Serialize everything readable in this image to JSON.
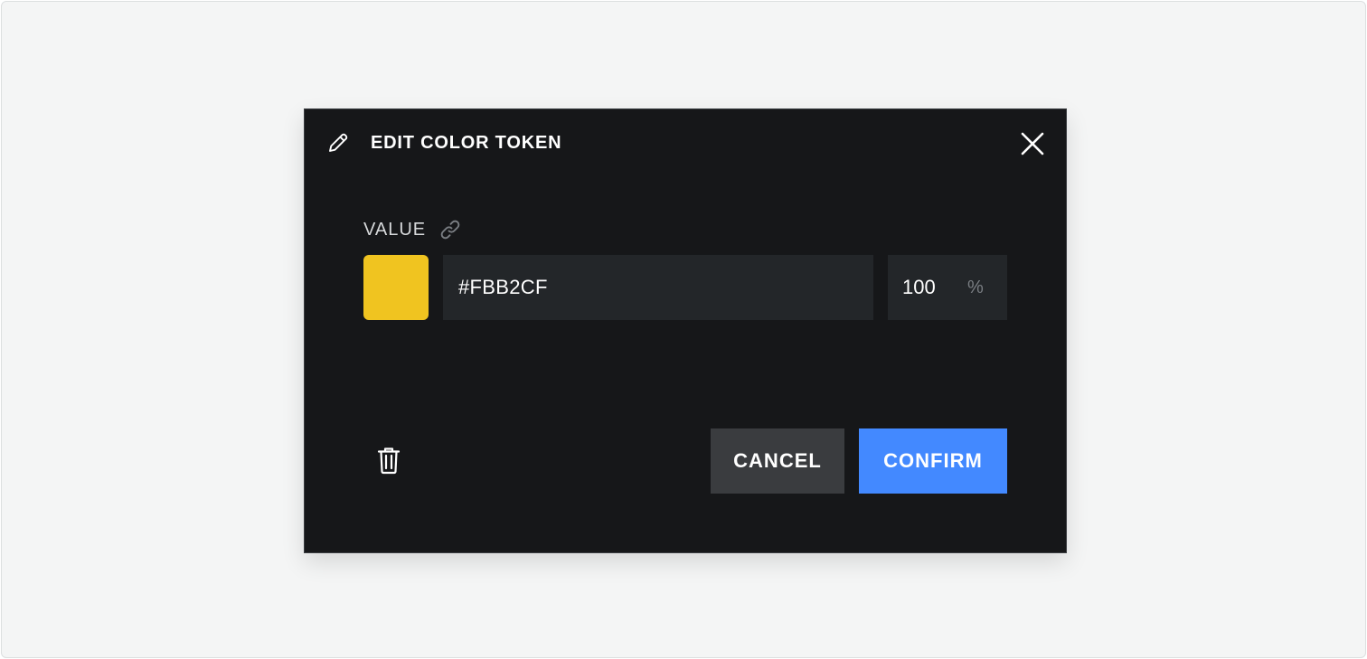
{
  "dialog": {
    "title": "EDIT COLOR TOKEN",
    "title_icon": "pencil-icon",
    "close_icon": "close-icon"
  },
  "value_field": {
    "label": "VALUE",
    "link_icon": "link-icon",
    "swatch_color": "#f0c420",
    "hex_value": "#FBB2CF",
    "opacity_value": "100",
    "opacity_unit": "%"
  },
  "footer": {
    "delete_icon": "trash-icon",
    "cancel_label": "CANCEL",
    "confirm_label": "CONFIRM"
  },
  "colors": {
    "background": "#f4f5f5",
    "dialog_background": "#161719",
    "input_background": "#232629",
    "cancel_background": "#3a3c3f",
    "confirm_background": "#4389ff"
  }
}
